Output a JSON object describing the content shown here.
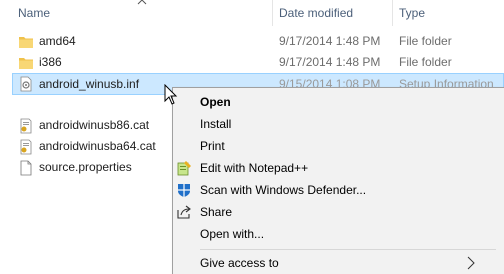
{
  "header": {
    "name": "Name",
    "date_modified": "Date modified",
    "type": "Type"
  },
  "files": [
    {
      "name": "amd64",
      "date": "9/17/2014 1:48 PM",
      "type": "File folder",
      "icon": "folder-icon"
    },
    {
      "name": "i386",
      "date": "9/17/2014 1:48 PM",
      "type": "File folder",
      "icon": "folder-icon"
    },
    {
      "name": "android_winusb.inf",
      "date": "9/15/2014 1:08 PM",
      "type": "Setup Information",
      "icon": "setup-info-icon",
      "selected": true
    },
    {
      "name": "androidwinusb86.cat",
      "date": "",
      "type": "",
      "icon": "security-catalog-icon"
    },
    {
      "name": "androidwinusba64.cat",
      "date": "",
      "type": "",
      "icon": "security-catalog-icon"
    },
    {
      "name": "source.properties",
      "date": "",
      "type": "",
      "icon": "file-icon"
    }
  ],
  "context_menu": {
    "items": [
      {
        "label": "Open",
        "bold": true
      },
      {
        "label": "Install"
      },
      {
        "label": "Print"
      },
      {
        "label": "Edit with Notepad++",
        "icon": "notepadpp-icon"
      },
      {
        "label": "Scan with Windows Defender...",
        "icon": "windows-defender-icon"
      },
      {
        "label": "Share",
        "icon": "share-icon"
      },
      {
        "label": "Open with..."
      },
      {
        "label": "Give access to",
        "submenu": true
      }
    ]
  },
  "colors": {
    "selection_bg": "#cce8ff",
    "selection_border": "#99d1ff",
    "header_text": "#4c607a",
    "menu_bg": "#f2f2f2",
    "folder_yellow": "#f8d775"
  }
}
